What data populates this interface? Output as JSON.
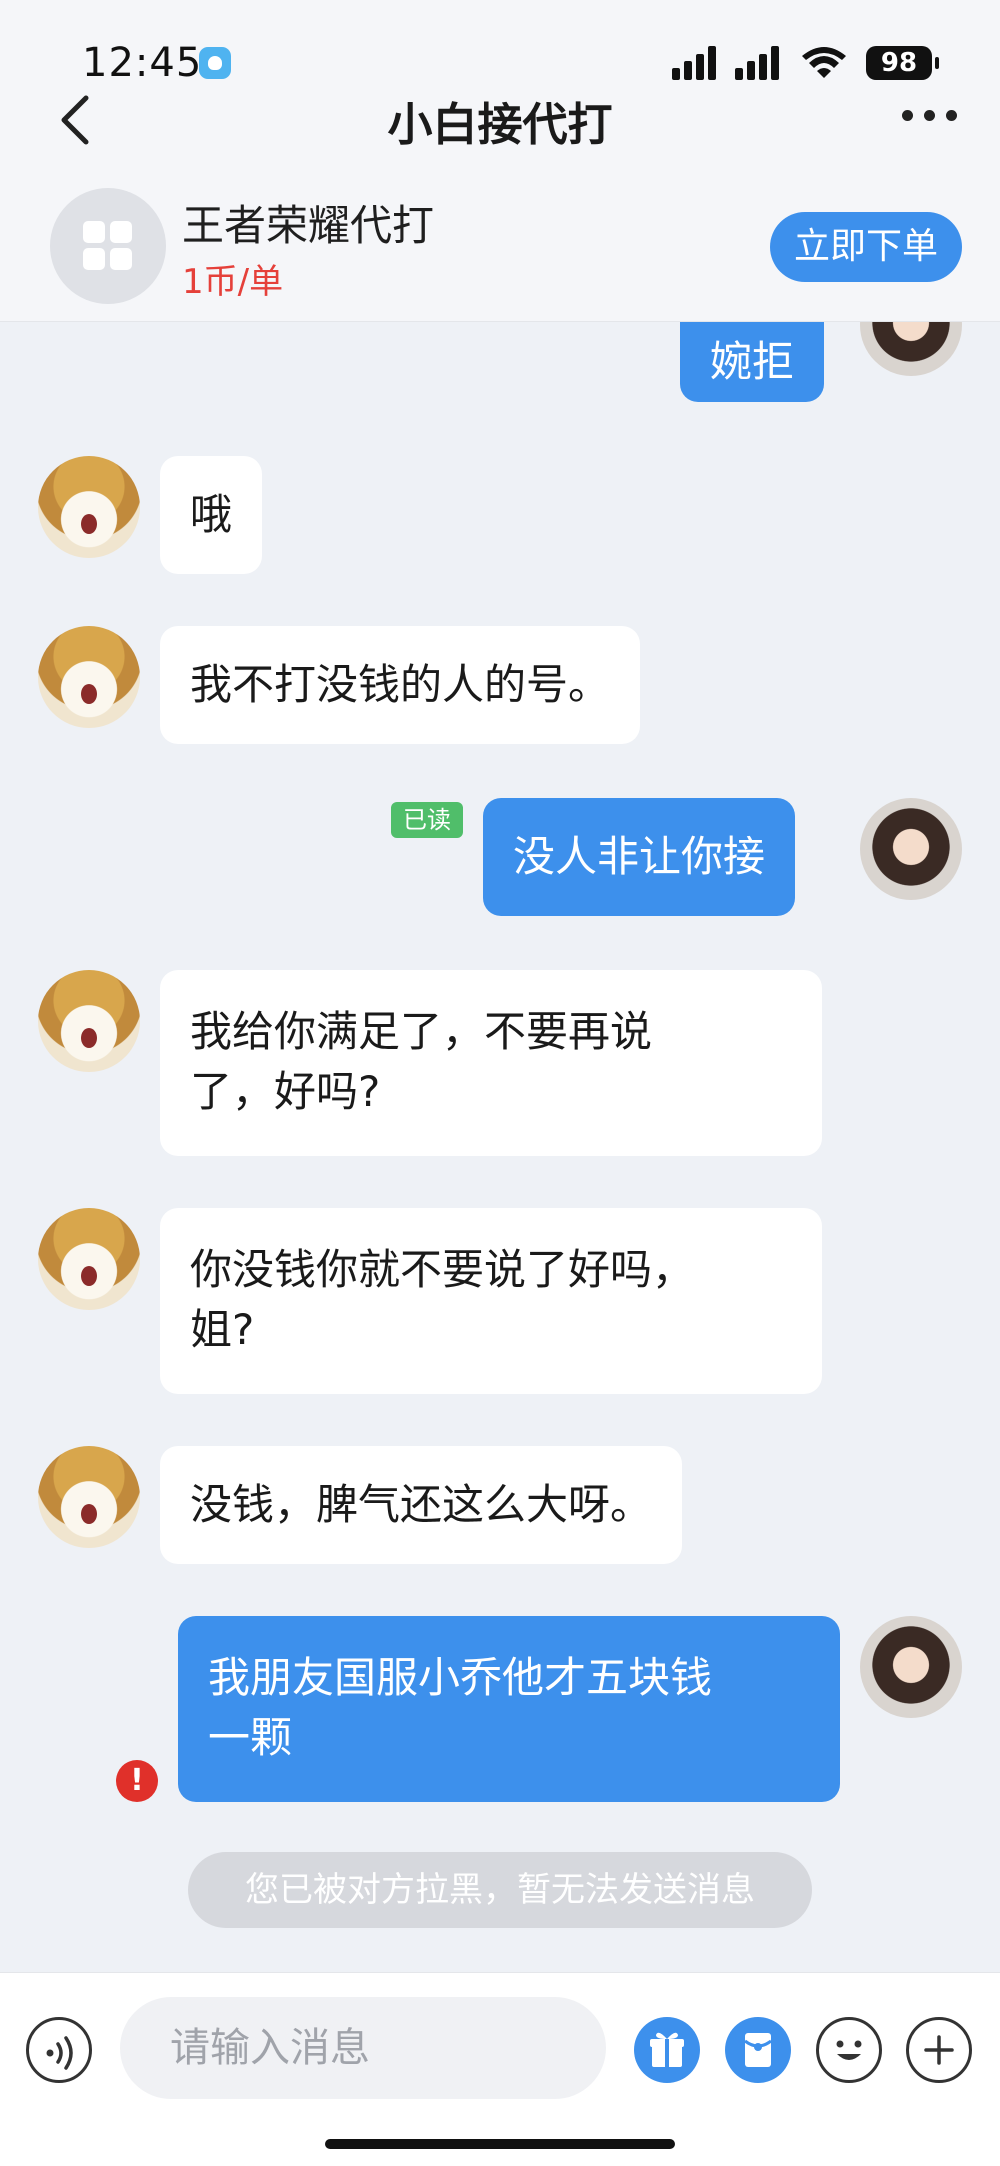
{
  "status_bar": {
    "time": "12:45",
    "battery": "98"
  },
  "navbar": {
    "title": "小白接代打"
  },
  "service": {
    "name": "王者荣耀代打",
    "price": "1币/单",
    "order_button": "立即下单"
  },
  "messages": [
    {
      "from": "me",
      "text": "婉拒"
    },
    {
      "from": "other",
      "text": "哦"
    },
    {
      "from": "other",
      "text": "我不打没钱的人的号。"
    },
    {
      "from": "me",
      "text": "没人非让你接",
      "read_label": "已读"
    },
    {
      "from": "other",
      "text": "我给你满足了，不要再说\n了，好吗?"
    },
    {
      "from": "other",
      "text": "你没钱你就不要说了好吗，\n姐?"
    },
    {
      "from": "other",
      "text": "没钱，脾气还这么大呀。"
    },
    {
      "from": "me",
      "text": "我朋友国服小乔他才五块钱\n一颗",
      "status": "!"
    }
  ],
  "blocked_notice": "您已被对方拉黑，暂无法发送消息",
  "input_bar": {
    "placeholder": "请输入消息"
  },
  "icons": [
    "back-icon",
    "more-icon",
    "voice-icon",
    "gift-icon",
    "red-packet-icon",
    "emoji-icon",
    "plus-icon"
  ],
  "colors": {
    "accent": "#3d90ec",
    "price": "#e5403a",
    "read": "#50be6a",
    "error": "#e0302a"
  }
}
